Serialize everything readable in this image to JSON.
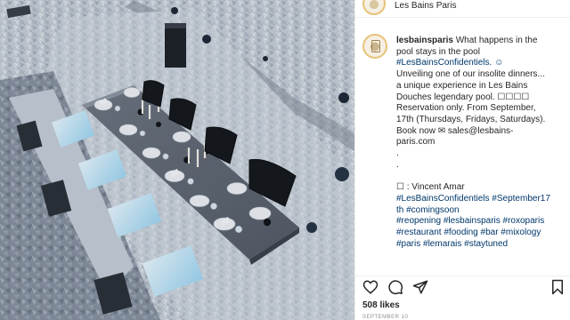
{
  "header": {
    "account_name": "Les Bains Paris"
  },
  "post": {
    "username": "lesbainsparis",
    "caption_lines": [
      {
        "text": " What happens in the",
        "kind": "plain"
      },
      {
        "text": "pool stays in the pool",
        "kind": "plain"
      },
      {
        "text": "#LesBainsConfidentiels. ☺",
        "kind": "tag-mixed"
      },
      {
        "text": "Unveiling one of our insolite dinners...",
        "kind": "plain"
      },
      {
        "text": "a unique experience in Les Bains",
        "kind": "plain"
      },
      {
        "text": "Douches legendary pool. ☐☐☐☐",
        "kind": "plain"
      },
      {
        "text": "Reservation only. From September,",
        "kind": "plain"
      },
      {
        "text": "17th (Thursdays, Fridays, Saturdays).",
        "kind": "plain"
      },
      {
        "text": "Book now ✉ sales@lesbains-",
        "kind": "plain"
      },
      {
        "text": "paris.com",
        "kind": "plain"
      },
      {
        "text": ".",
        "kind": "plain"
      },
      {
        "text": ".",
        "kind": "plain"
      },
      {
        "text": "",
        "kind": "plain"
      },
      {
        "text": "☐ : Vincent Amar",
        "kind": "plain"
      },
      {
        "text": "#LesBainsConfidentiels #September17",
        "kind": "tag"
      },
      {
        "text": "th #comingsoon",
        "kind": "tag"
      },
      {
        "text": "#reopening #lesbainsparis #roxoparis",
        "kind": "tag"
      },
      {
        "text": "#restaurant #fooding #bar #mixology",
        "kind": "tag"
      },
      {
        "text": "#paris #lemarais #staytuned",
        "kind": "tag"
      }
    ]
  },
  "actions": {
    "like_icon": "heart-icon",
    "comment_icon": "comment-icon",
    "share_icon": "share-icon",
    "save_icon": "bookmark-icon"
  },
  "likes": "508 likes",
  "date": "SEPTEMBER 10",
  "colors": {
    "text": "#262626",
    "hashtag": "#00376b",
    "muted": "#8e8e8e",
    "border": "#efefef",
    "avatar_ring": "#e7c37a"
  }
}
